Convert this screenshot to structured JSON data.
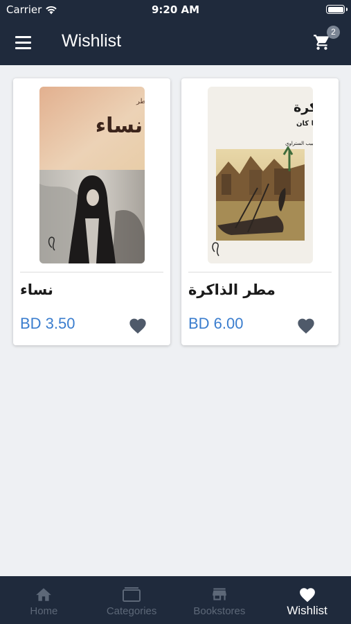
{
  "status_bar": {
    "carrier": "Carrier",
    "time": "9:20 AM"
  },
  "header": {
    "title": "Wishlist",
    "cart_count": "2"
  },
  "wishlist": [
    {
      "title": "نساء",
      "price": "BD 3.50",
      "cover_author": "فوزية مطر",
      "cover_title": "نساء"
    },
    {
      "title": "مطر الذاكرة",
      "price": "BD 6.00",
      "cover_title": "مطر الذاكرة",
      "cover_subtitle": "سيرة الوجدان في ما كان",
      "cover_author": "جمعة حبيب الستراوي"
    }
  ],
  "tabs": [
    {
      "label": "Home",
      "icon": "home-icon",
      "active": false
    },
    {
      "label": "Categories",
      "icon": "folder-icon",
      "active": false
    },
    {
      "label": "Bookstores",
      "icon": "store-icon",
      "active": false
    },
    {
      "label": "Wishlist",
      "icon": "heart-icon",
      "active": true
    }
  ],
  "colors": {
    "primary": "#1f2a3c",
    "price": "#3a7dce",
    "background": "#eef0f3",
    "heart": "#4f5a6a"
  }
}
